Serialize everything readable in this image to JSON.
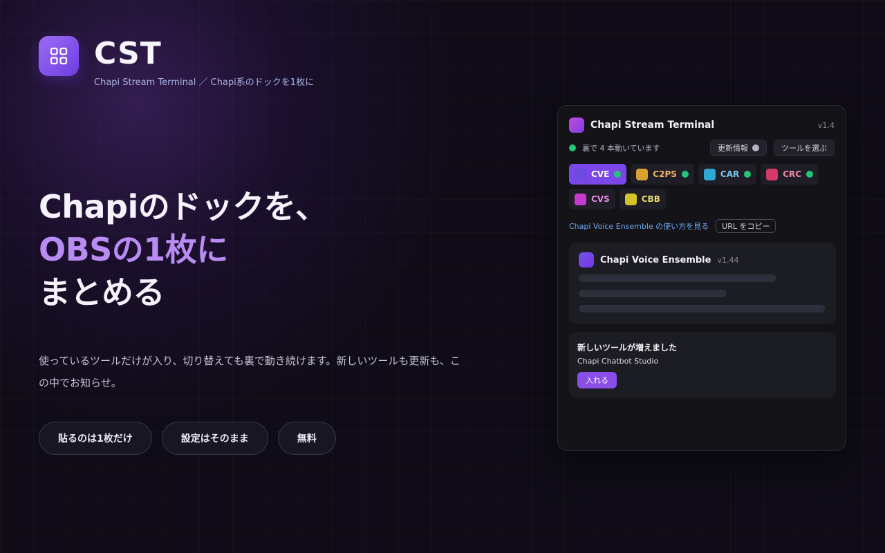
{
  "brand": {
    "title": "CST",
    "subtitle": "Chapi Stream Terminal ／ Chapi系のドックを1枚に",
    "logo_icon": "grid-icon"
  },
  "hero": {
    "line1": "Chapiのドックを、",
    "line2": "OBSの1枚に",
    "line3": "まとめる",
    "accent_color": "#b98cf4"
  },
  "description": "使っているツールだけが入り、切り替えても裏で動き続けます。新しいツールも更新も、この中でお知らせ。",
  "features": [
    "貼るのは1枚だけ",
    "設定はそのまま",
    "無料"
  ],
  "panel": {
    "title": "Chapi Stream Terminal",
    "version": "v1.4",
    "status": "裏で 4 本動いています",
    "updates_button": "更新情報",
    "select_tools_button": "ツールを選ぶ",
    "tools": [
      {
        "label": "CVE",
        "color": "#6a4be0",
        "text_color": "#ffffff",
        "running": true,
        "active": true
      },
      {
        "label": "C2PS",
        "color": "#d9a030",
        "text_color": "#f1b764",
        "running": true,
        "active": false
      },
      {
        "label": "CAR",
        "color": "#2ea8d8",
        "text_color": "#7cc4ec",
        "running": true,
        "active": false
      },
      {
        "label": "CRC",
        "color": "#d63a66",
        "text_color": "#ef8aa8",
        "running": true,
        "active": false
      },
      {
        "label": "CVS",
        "color": "#c83ad0",
        "text_color": "#e58ee6",
        "running": false,
        "active": false
      },
      {
        "label": "CBB",
        "color": "#d6c32a",
        "text_color": "#ead86a",
        "running": false,
        "active": false
      }
    ],
    "help_link": "Chapi Voice Ensemble の使い方を見る",
    "copy_url_button": "URL をコピー",
    "embedded_tool": {
      "title": "Chapi Voice Ensemble",
      "version": "v1.44"
    },
    "notice": {
      "title": "新しいツールが増えました",
      "tool_name": "Chapi Chatbot Studio",
      "install_button": "入れる"
    }
  },
  "colors": {
    "background": "#0f0c17",
    "brand_purple": "#7b47e8",
    "running_green": "#24c47a",
    "link_blue": "#6da8f0"
  }
}
